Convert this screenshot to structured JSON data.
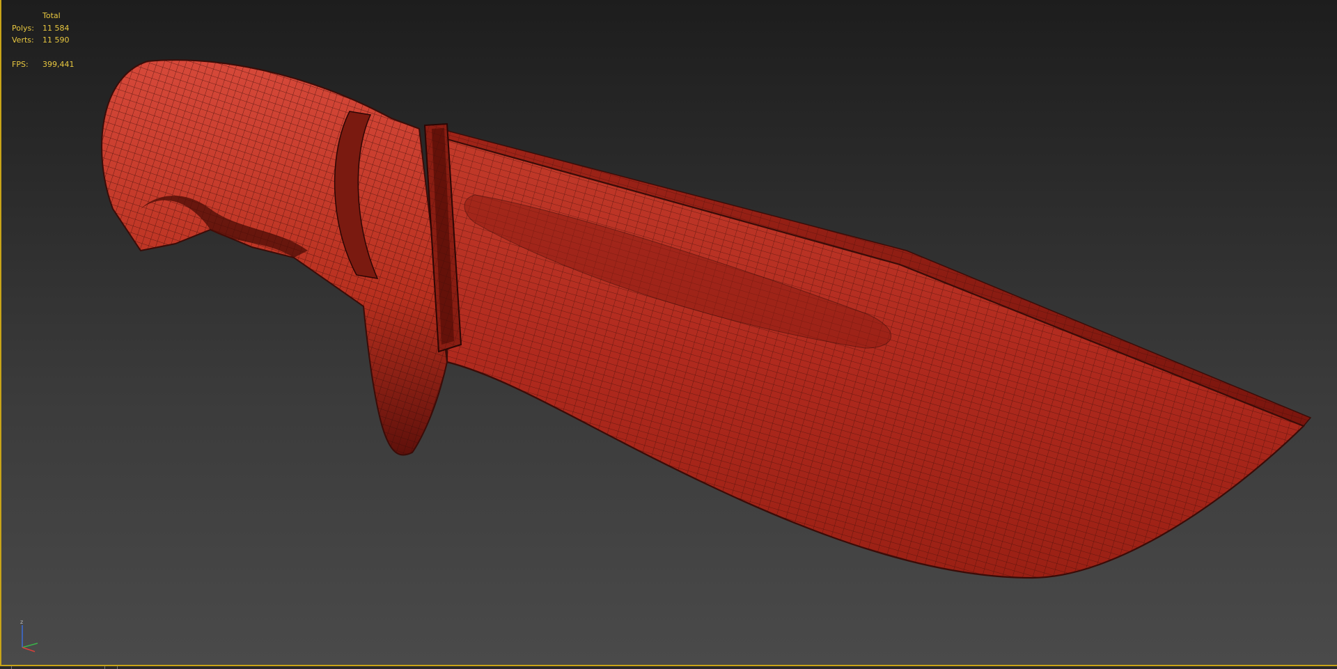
{
  "viewport": {
    "name": "perspective-viewport",
    "border_color": "#c8a418"
  },
  "stats": {
    "header": "Total",
    "polys_label": "Polys:",
    "polys_value": "11 584",
    "verts_label": "Verts:",
    "verts_value": "11 590",
    "fps_label": "FPS:",
    "fps_value": "399,441",
    "text_color": "#e9c840"
  },
  "model": {
    "object": "knife-mesh",
    "display_mode": "wireframe-over-shaded",
    "base_color": "#b02a1e",
    "wire_color": "#3a0c08"
  },
  "axis_gizmo": {
    "z_label": "z",
    "icon": "view-axis-tripod-icon"
  }
}
